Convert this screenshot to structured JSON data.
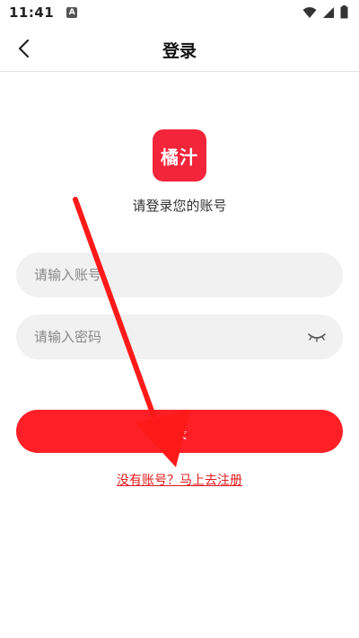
{
  "status_bar": {
    "time": "11:41",
    "notification_badge": "A"
  },
  "header": {
    "title": "登录"
  },
  "logo": {
    "text": "橘汁"
  },
  "subtitle": "请登录您的账号",
  "form": {
    "account_placeholder": "请输入账号",
    "password_placeholder": "请输入密码"
  },
  "login_button": "录",
  "register_link": "没有账号？马上去注册",
  "colors": {
    "brand_red": "#ff1f26",
    "logo_red": "#f2253a",
    "link_red": "#e0191d",
    "input_bg": "#f1f1f1"
  }
}
